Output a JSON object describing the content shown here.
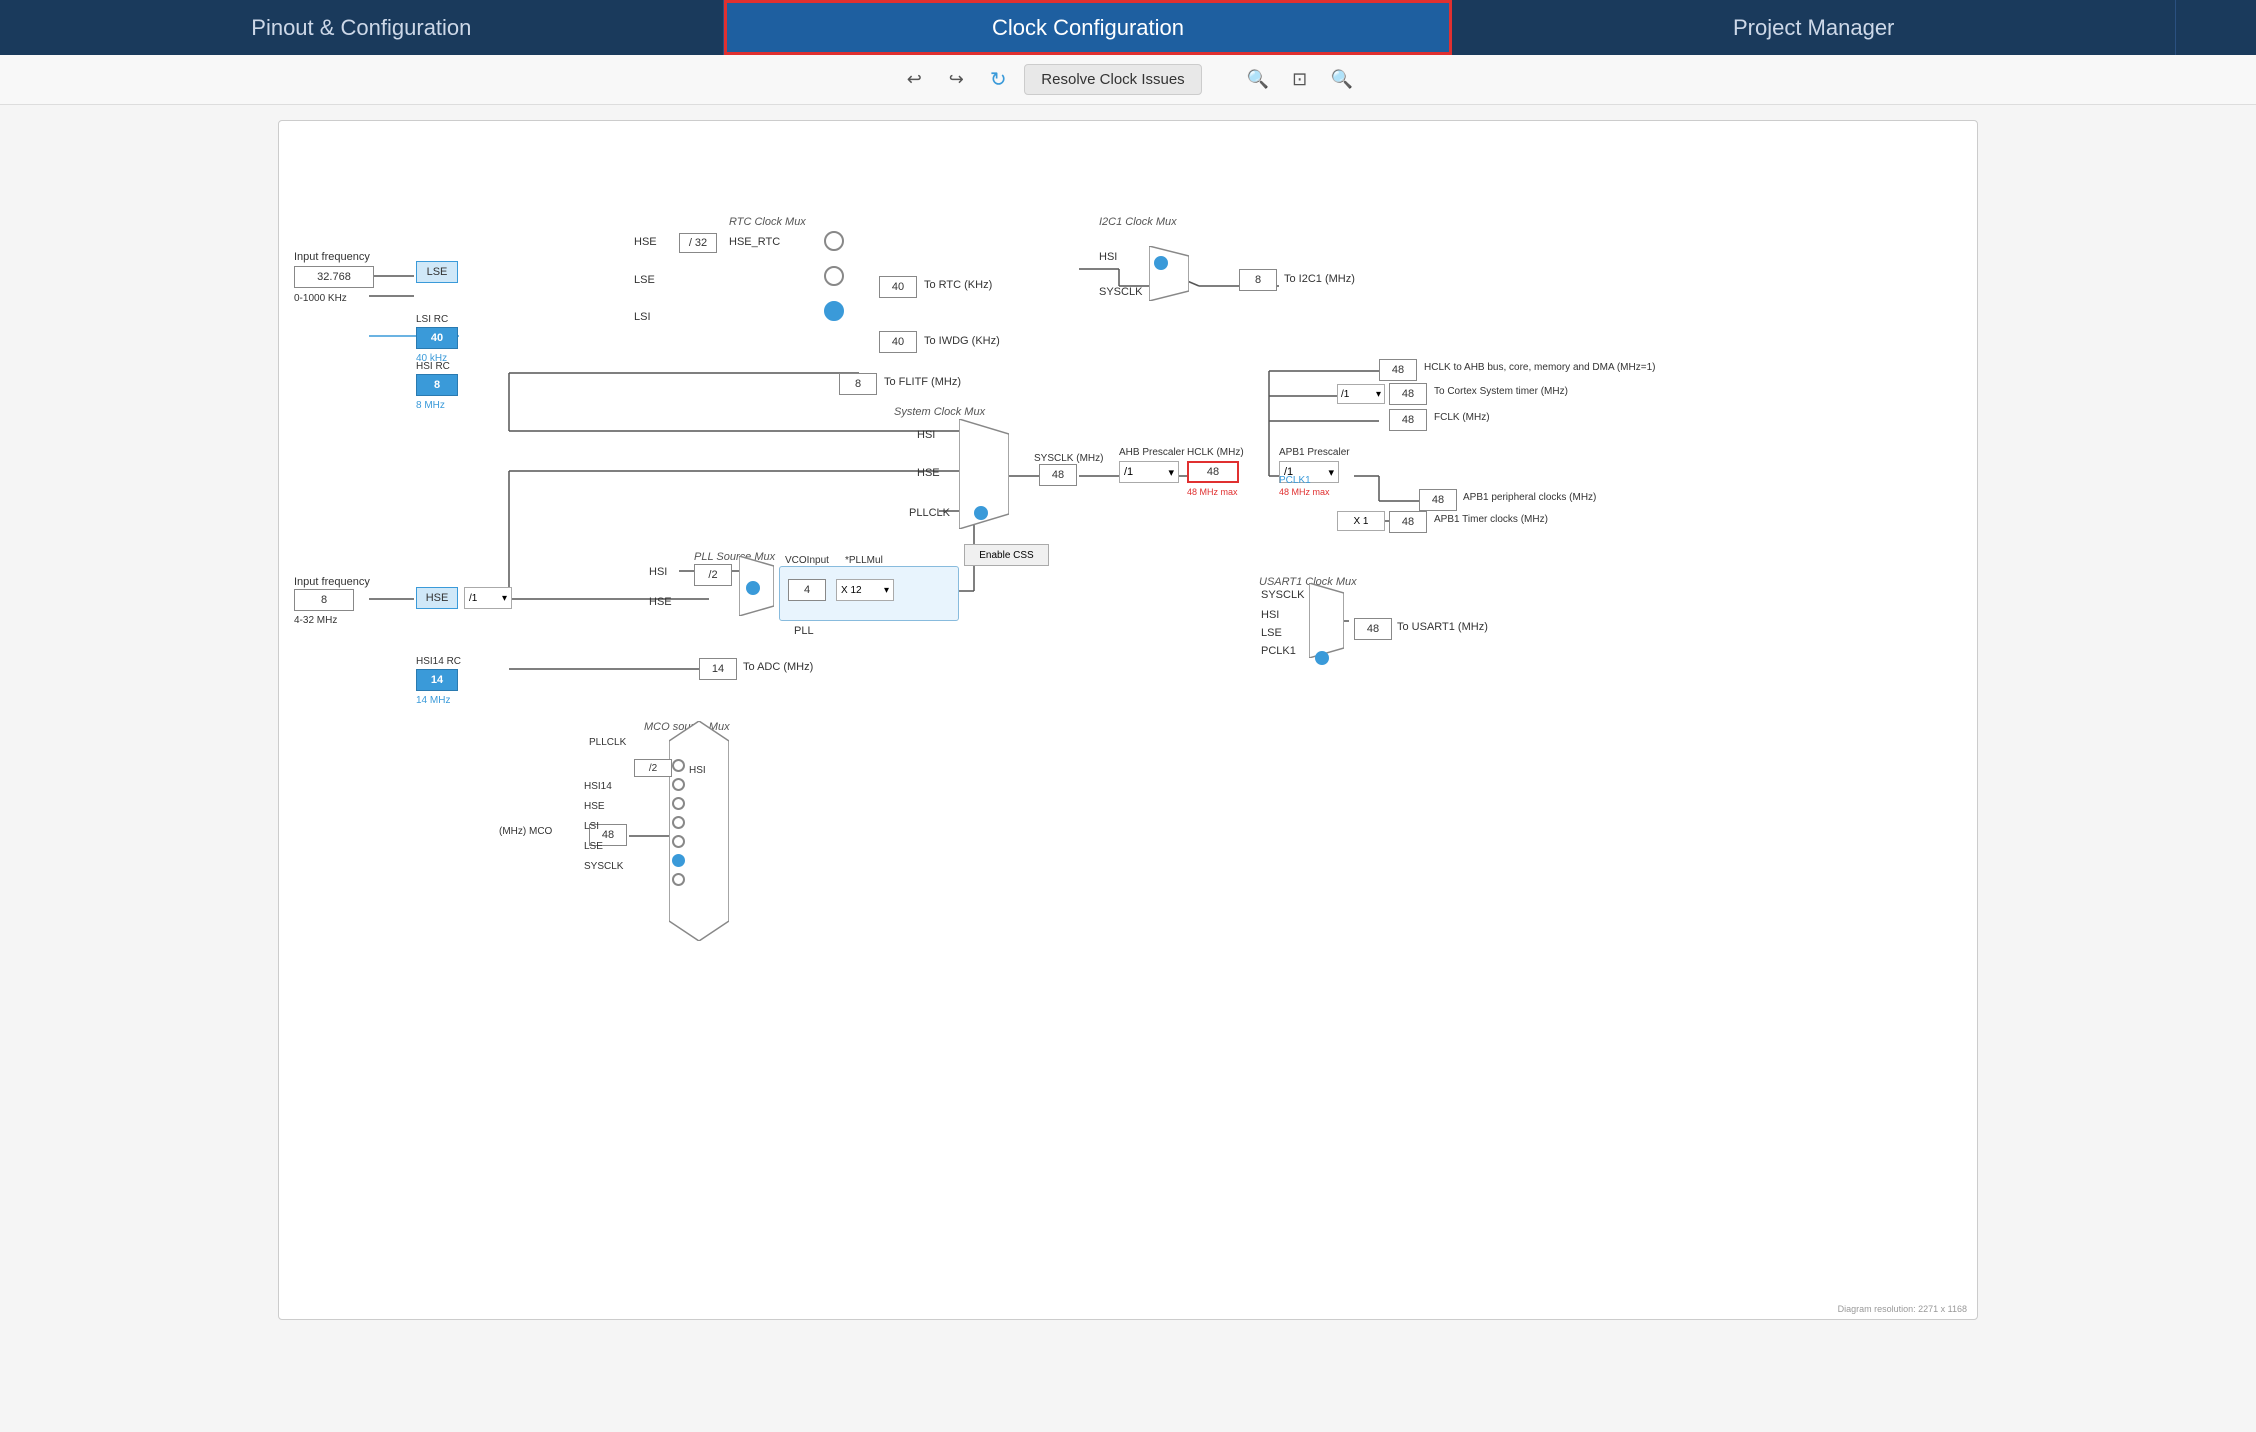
{
  "nav": {
    "items": [
      {
        "id": "pinout",
        "label": "Pinout & Configuration",
        "active": false
      },
      {
        "id": "clock",
        "label": "Clock Configuration",
        "active": true
      },
      {
        "id": "project",
        "label": "Project Manager",
        "active": false
      },
      {
        "id": "tools",
        "label": "",
        "active": false
      }
    ]
  },
  "toolbar": {
    "undo_label": "↩",
    "redo_label": "↪",
    "refresh_label": "↻",
    "resolve_label": "Resolve Clock Issues",
    "zoom_in_label": "⊕",
    "fit_label": "⊡",
    "zoom_out_label": "⊖"
  },
  "diagram": {
    "rtc_clock_mux_label": "RTC Clock Mux",
    "i2c1_clock_mux_label": "I2C1 Clock Mux",
    "system_clock_mux_label": "System Clock Mux",
    "pll_source_mux_label": "PLL Source Mux",
    "usart1_clock_mux_label": "USART1 Clock Mux",
    "mco_source_mux_label": "MCO source Mux",
    "input_freq_label1": "Input frequency",
    "input_freq_val1": "32.768",
    "input_freq_range1": "0-1000 KHz",
    "input_freq_label2": "Input frequency",
    "input_freq_val2": "8",
    "input_freq_range2": "4-32 MHz",
    "lse_label": "LSE",
    "lsi_label": "LSI",
    "lsi_rc_label": "LSI RC",
    "lsi_rc_val": "40",
    "lsi_rc_freq": "40 kHz",
    "hsi_rc_label": "HSI RC",
    "hsi_rc_val": "8",
    "hsi_rc_freq": "8 MHz",
    "hse_label": "HSE",
    "hsi14_rc_label": "HSI14 RC",
    "hsi14_rc_val": "14",
    "hsi14_rc_freq": "14 MHz",
    "hse_div32_label": "/ 32",
    "hse_rtc_label": "HSE_RTC",
    "to_rtc_label": "To RTC (KHz)",
    "to_iwdg_label": "To IWDG (KHz)",
    "rtc_40_1": "40",
    "rtc_40_2": "40",
    "to_flitf_label": "To FLITF (MHz)",
    "flitf_8": "8",
    "hsi_label": "HSI",
    "hse_label2": "HSE",
    "pllclk_label": "PLLCLK",
    "sysclk_mhz_label": "SYSCLK (MHz)",
    "sysclk_val": "48",
    "ahb_prescaler_label": "AHB Prescaler",
    "ahb_div": "/1",
    "hclk_mhz_label": "HCLK (MHz)",
    "hclk_val": "48",
    "hclk_max": "48 MHz max",
    "apb1_prescaler_label": "APB1 Prescaler",
    "apb1_div": "/1",
    "pclk1_label": "PCLK1",
    "pclk1_max": "48 MHz max",
    "hclk_ahb_label": "HCLK to AHB bus, core, memory and DMA (MHz=1)",
    "hclk_ahb_val": "48",
    "cortex_timer_label": "To Cortex System timer (MHz)",
    "cortex_timer_val": "48",
    "fclk_label": "FCLK (MHz)",
    "fclk_val": "48",
    "apb1_periph_label": "APB1 peripheral clocks (MHz)",
    "apb1_periph_val": "48",
    "apb1_timer_label": "APB1 Timer clocks (MHz)",
    "apb1_timer_val": "48",
    "x1_label": "X 1",
    "to_i2c1_label": "To I2C1 (MHz)",
    "to_i2c1_val": "8",
    "i2c1_val": "8",
    "enable_css_label": "Enable CSS",
    "pll_hsi_label": "HSI",
    "pll_hse_label": "HSE",
    "pll_div2_label": "/2",
    "pll_div1_label": "/1",
    "vco_input_label": "VCOInput",
    "pll_mul_label": "*PLLMul",
    "vco_val": "4",
    "pll_x12_label": "X 12",
    "pll_label": "PLL",
    "sysclk_label": "SYSCLK",
    "hsi_u1": "HSI",
    "lse_u1": "LSE",
    "pclk1_u1": "PCLK1",
    "to_usart1_label": "To USART1 (MHz)",
    "to_usart1_val": "48",
    "to_adc_label": "To ADC (MHz)",
    "adc_val": "14",
    "mco_val": "48",
    "mco_mhz_label": "(MHz) MCO",
    "mco_pllclk": "PLLCLK",
    "mco_div2": "/2",
    "mco_hsi": "HSI",
    "mco_hsi14": "HSI14",
    "mco_hse": "HSE",
    "mco_lsi": "LSI",
    "mco_lse": "LSE",
    "mco_sysclk": "SYSCLK"
  }
}
